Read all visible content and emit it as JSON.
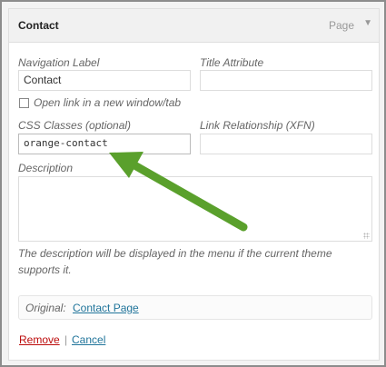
{
  "header": {
    "title": "Contact",
    "type": "Page"
  },
  "fields": {
    "nav_label": {
      "label": "Navigation Label",
      "value": "Contact"
    },
    "title_attr": {
      "label": "Title Attribute",
      "value": ""
    },
    "new_window": {
      "label": "Open link in a new window/tab",
      "checked": false
    },
    "css_classes": {
      "label": "CSS Classes (optional)",
      "value": "orange-contact"
    },
    "link_rel": {
      "label": "Link Relationship (XFN)",
      "value": ""
    },
    "description": {
      "label": "Description",
      "value": "",
      "help_line1": "The description will be displayed in the menu if the current theme",
      "help_line2": "supports it."
    }
  },
  "original": {
    "label": "Original:",
    "link": "Contact Page"
  },
  "actions": {
    "remove": "Remove",
    "separator": "|",
    "cancel": "Cancel"
  },
  "colors": {
    "arrow": "#5aa02c",
    "link": "#21759b",
    "remove": "#bc0b0b"
  },
  "icons": {
    "header_toggle": "triangle-down-icon",
    "annotation": "arrow-icon"
  }
}
